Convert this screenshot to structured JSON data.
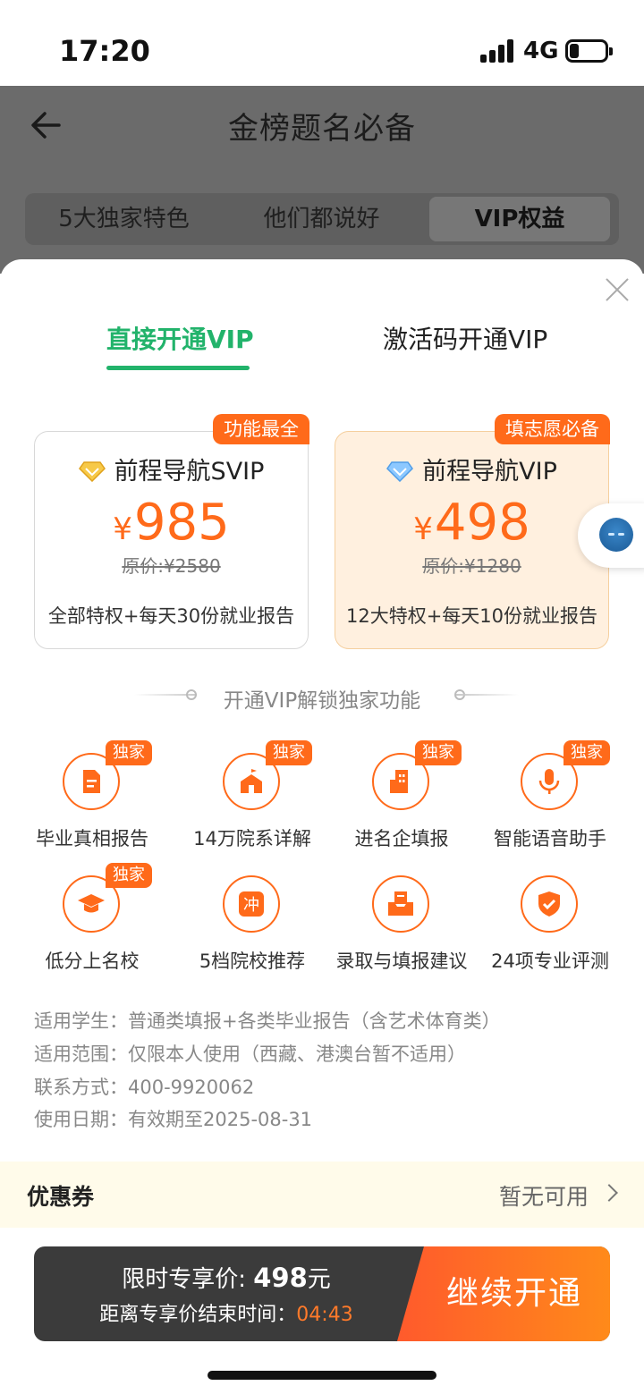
{
  "status_bar": {
    "time": "17:20",
    "network": "4G"
  },
  "page": {
    "title": "金榜题名必备",
    "segments": [
      {
        "label": "5大独家特色"
      },
      {
        "label": "他们都说好"
      },
      {
        "label": "VIP权益"
      }
    ]
  },
  "sheet": {
    "tabs": [
      {
        "label": "直接开通VIP",
        "active": true
      },
      {
        "label": "激活码开通VIP",
        "active": false
      }
    ],
    "plans": [
      {
        "badge": "功能最全",
        "name": "前程导航SVIP",
        "currency": "¥",
        "price": "985",
        "original": "原价:¥2580",
        "desc": "全部特权+每天30份就业报告"
      },
      {
        "badge": "填志愿必备",
        "name": "前程导航VIP",
        "currency": "¥",
        "price": "498",
        "original": "原价:¥1280",
        "desc": "12大特权+每天10份就业报告"
      }
    ],
    "features_title": "开通VIP解锁独家功能",
    "features": [
      {
        "label": "毕业真相报告",
        "badge": "独家",
        "icon": "report-icon"
      },
      {
        "label": "14万院系详解",
        "badge": "独家",
        "icon": "school-icon"
      },
      {
        "label": "进名企填报",
        "badge": "独家",
        "icon": "building-icon"
      },
      {
        "label": "智能语音助手",
        "badge": "独家",
        "icon": "microphone-icon"
      },
      {
        "label": "低分上名校",
        "badge": "独家",
        "icon": "graduation-cap-icon"
      },
      {
        "label": "5档院校推荐",
        "badge": "",
        "icon": "chong-icon",
        "glyph": "冲"
      },
      {
        "label": "录取与填报建议",
        "badge": "",
        "icon": "inbox-icon"
      },
      {
        "label": "24项专业评测",
        "badge": "",
        "icon": "shield-check-icon"
      }
    ],
    "info": [
      {
        "key": "适用学生：",
        "value": "普通类填报+各类毕业报告（含艺术体育类）"
      },
      {
        "key": "适用范围：",
        "value": "仅限本人使用（西藏、港澳台暂不适用）"
      },
      {
        "key": "联系方式：",
        "value": "400-9920062"
      },
      {
        "key": "使用日期：",
        "value": "有效期至2025-08-31"
      }
    ],
    "coupon": {
      "label": "优惠券",
      "value": "暂无可用"
    },
    "purchase": {
      "price_prefix": "限时专享价: ",
      "price": "498",
      "price_unit": "元",
      "timer_prefix": "距离专享价结束时间：",
      "timer": "04:43",
      "cta": "继续开通"
    }
  },
  "colors": {
    "accent": "#ff6a1a",
    "tab_active": "#22b36b",
    "coupon_bg": "#fffbea"
  }
}
